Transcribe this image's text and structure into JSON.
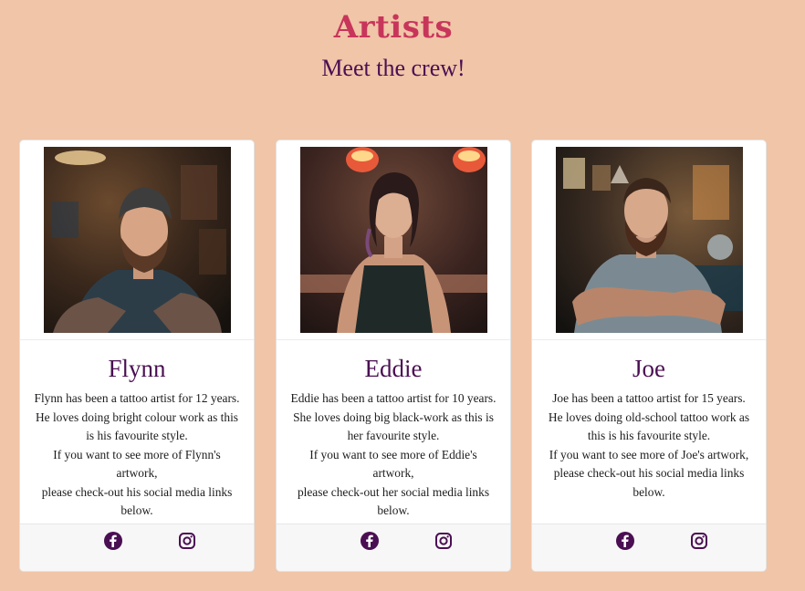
{
  "header": {
    "title": "Artists",
    "subtitle": "Meet the crew!"
  },
  "colors": {
    "background": "#f0c5a8",
    "title": "#c8355a",
    "accent": "#4a0f52"
  },
  "artists": [
    {
      "name": "Flynn",
      "bio_lines": [
        "Flynn has been a tattoo artist for 12 years.",
        "He loves doing bright colour work as this",
        "is his favourite style.",
        "If you want to see more of Flynn's artwork,",
        "please check-out his social media links",
        "below."
      ],
      "icons": [
        "facebook-icon",
        "instagram-icon"
      ]
    },
    {
      "name": "Eddie",
      "bio_lines": [
        "Eddie has been a tattoo artist for 10 years.",
        "She loves doing big black-work as this is",
        "her favourite style.",
        "If you want to see more of Eddie's artwork,",
        "please check-out her social media links",
        "below."
      ],
      "icons": [
        "facebook-icon",
        "instagram-icon"
      ]
    },
    {
      "name": "Joe",
      "bio_lines": [
        "Joe has been a tattoo artist for 15 years.",
        "He loves doing old-school tattoo work as",
        "this is his favourite style.",
        "If you want to see more of Joe's artwork,",
        "please check-out his social media links",
        "below."
      ],
      "icons": [
        "facebook-icon",
        "instagram-icon"
      ]
    }
  ]
}
